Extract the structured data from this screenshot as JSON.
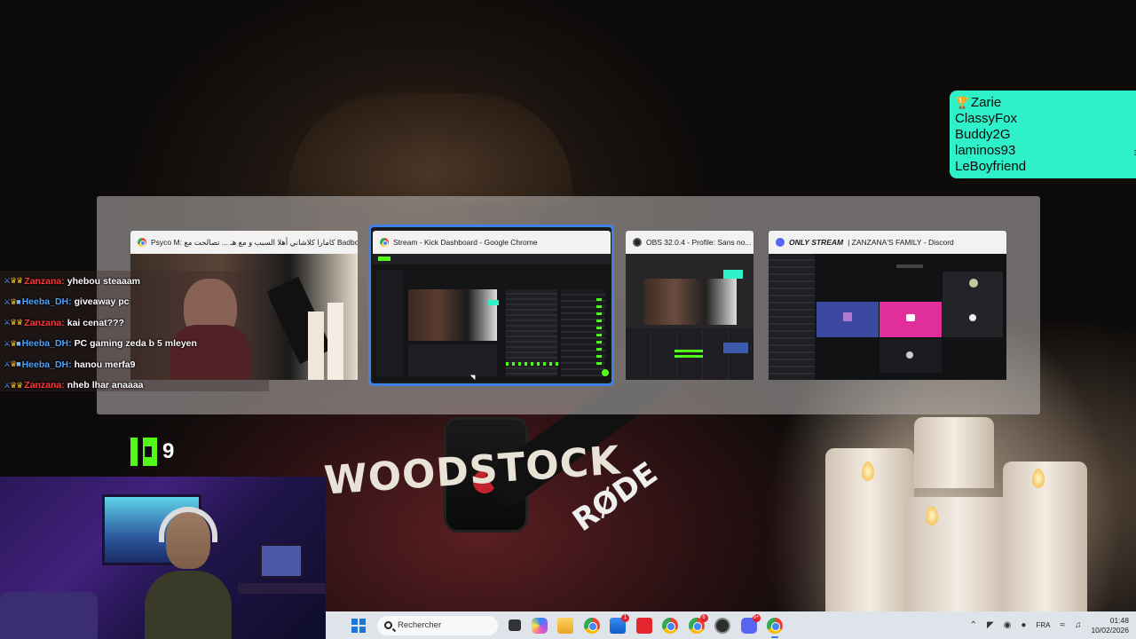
{
  "leaderboard": {
    "entries": [
      "Zarie",
      "ClassyFox",
      "Buddy2G",
      "laminos93",
      "LeBoyfriend"
    ],
    "edge_char": "3"
  },
  "task_switcher": {
    "windows": [
      {
        "app": "chrome",
        "title": "Psyco M: كامارا كلاشاني أهلا السبب و مع هـ ... تصالحت مع Badboy"
      },
      {
        "app": "chrome",
        "title": "Stream - Kick Dashboard - Google Chrome",
        "selected": true
      },
      {
        "app": "obs",
        "title": "OBS 32.0.4 - Profile: Sans no..."
      },
      {
        "app": "discord",
        "title": "ONLY STREAM | ZANZANA'S FAMILY - Discord",
        "title_prefix": "ONLY STREAM",
        "title_rest": " | ZANZANA'S FAMILY - Discord"
      }
    ]
  },
  "chat": {
    "messages": [
      {
        "user": "Zanzana",
        "color": "#ff3b3b",
        "text": "yhebou steaaam"
      },
      {
        "user": "Heeba_DH",
        "color": "#4aa3ff",
        "text": "giveaway pc"
      },
      {
        "user": "Zanzana",
        "color": "#ff3b3b",
        "text": "kai cenat???"
      },
      {
        "user": "Heeba_DH",
        "color": "#4aa3ff",
        "text": "PC gaming zeda b 5 mleyen"
      },
      {
        "user": "Heeba_DH",
        "color": "#4aa3ff",
        "text": "hanou merfa9"
      },
      {
        "user": "Zanzana",
        "color": "#ff3b3b",
        "text": "nheb lhar anaaaa"
      }
    ]
  },
  "viewer_count": {
    "value": "9",
    "platform_color": "#53fc18"
  },
  "stream_overlay": {
    "shirt_text": "WOODSTOCK",
    "mic_brand": "RØDE"
  },
  "taskbar": {
    "search_placeholder": "Rechercher",
    "language": "FRA",
    "time": "01:48",
    "date": "10/02/2026",
    "icons": [
      "start-icon",
      "search-icon",
      "task-view-icon",
      "copilot-icon",
      "file-explorer-icon",
      "chrome-icon",
      "store-icon",
      "wps-icon",
      "chrome-profile-icon",
      "chrome-profile-icon",
      "obs-icon",
      "discord-icon",
      "chrome-active-icon"
    ],
    "badges": {
      "store": "1",
      "chrome_profile": "6",
      "discord": "9+"
    }
  }
}
